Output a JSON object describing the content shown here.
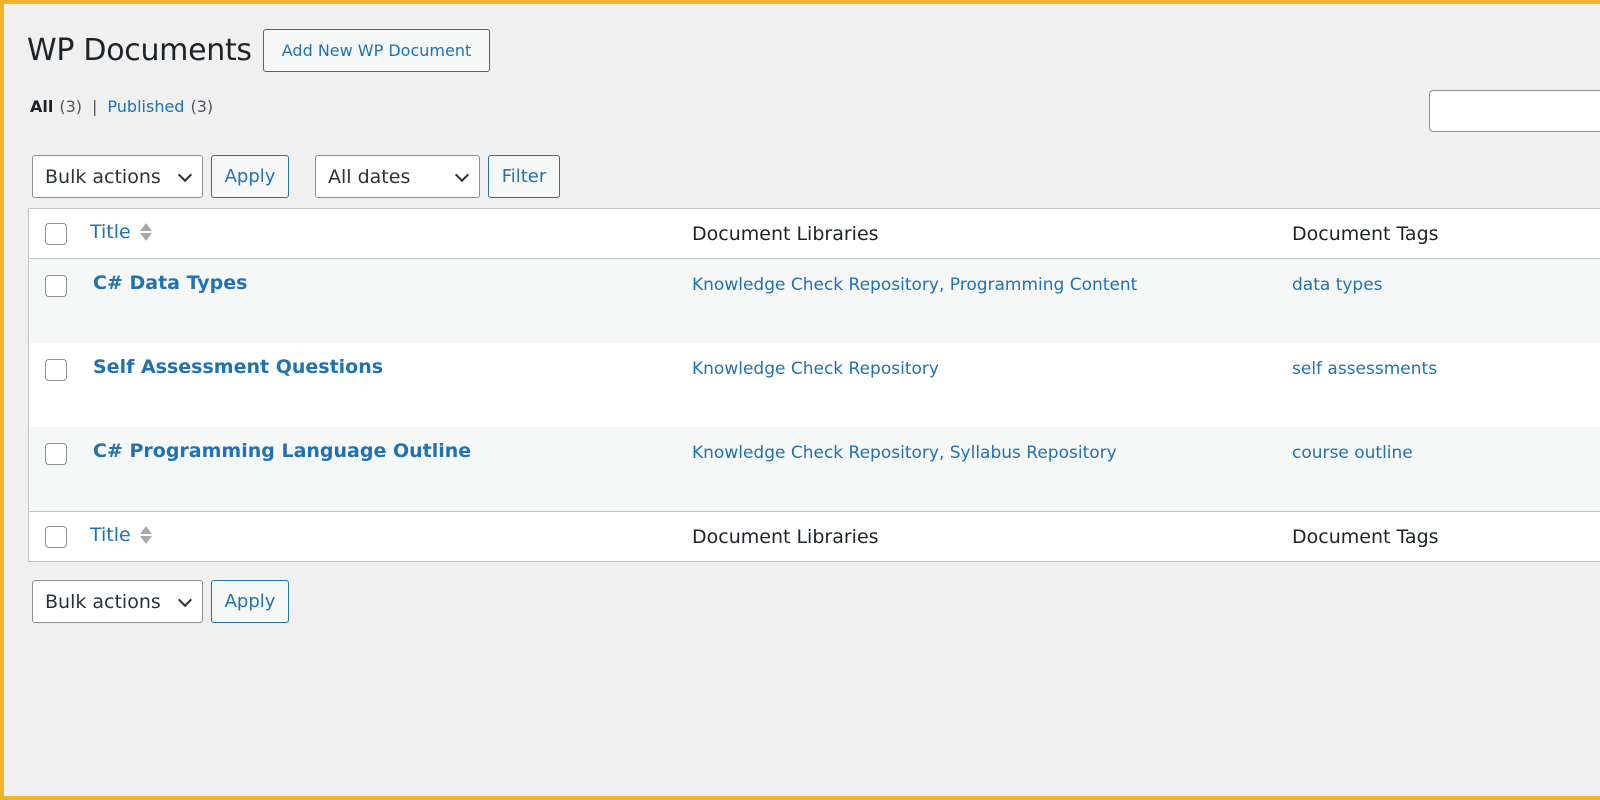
{
  "page": {
    "title": "WP Documents",
    "add_new_label": "Add New WP Document"
  },
  "views": {
    "all_label": "All",
    "all_count": "(3)",
    "separator": "|",
    "published_label": "Published",
    "published_count": "(3)"
  },
  "search": {
    "placeholder": ""
  },
  "tablenav_top": {
    "bulk_actions": "Bulk actions",
    "apply_label": "Apply",
    "dates_filter": "All dates",
    "filter_label": "Filter"
  },
  "table": {
    "columns": [
      "Title",
      "Document Libraries",
      "Document Tags"
    ],
    "rows": [
      {
        "title": "C# Data Types",
        "libraries": "Knowledge Check Repository, Programming Content",
        "tags": "data types"
      },
      {
        "title": "Self Assessment Questions",
        "libraries": "Knowledge Check Repository",
        "tags": "self assessments"
      },
      {
        "title": "C# Programming Language Outline",
        "libraries": "Knowledge Check Repository, Syllabus Repository",
        "tags": "course outline"
      }
    ]
  },
  "tablenav_bottom": {
    "bulk_actions": "Bulk actions",
    "apply_label": "Apply"
  },
  "colors": {
    "link": "#2271b1",
    "background": "#f0f0f1",
    "frame_border": "#f0b429"
  }
}
